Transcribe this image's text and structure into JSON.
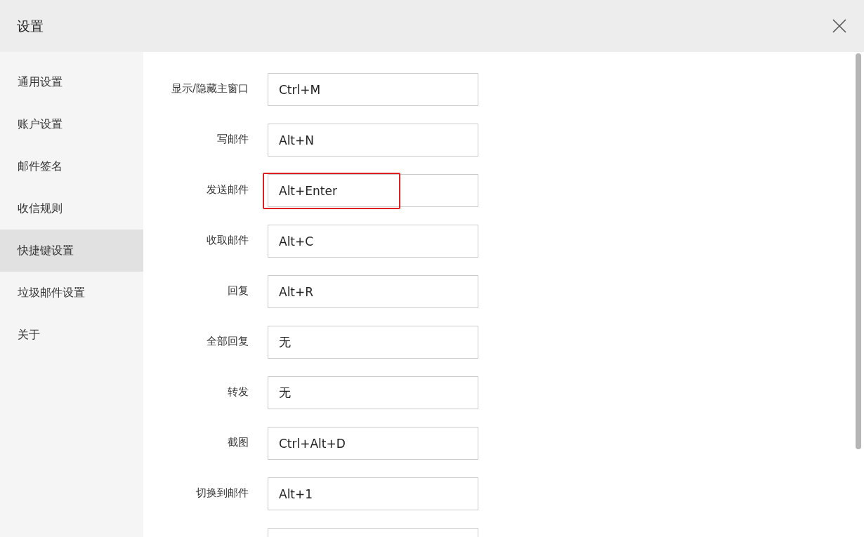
{
  "window": {
    "title": "设置"
  },
  "sidebar": {
    "items": [
      {
        "label": "通用设置",
        "selected": false
      },
      {
        "label": "账户设置",
        "selected": false
      },
      {
        "label": "邮件签名",
        "selected": false
      },
      {
        "label": "收信规则",
        "selected": false
      },
      {
        "label": "快捷键设置",
        "selected": true
      },
      {
        "label": "垃圾邮件设置",
        "selected": false
      },
      {
        "label": "关于",
        "selected": false
      }
    ]
  },
  "shortcuts": [
    {
      "label": "显示/隐藏主窗口",
      "value": "Ctrl+M",
      "highlighted": false
    },
    {
      "label": "写邮件",
      "value": "Alt+N",
      "highlighted": false
    },
    {
      "label": "发送邮件",
      "value": "Alt+Enter",
      "highlighted": true
    },
    {
      "label": "收取邮件",
      "value": "Alt+C",
      "highlighted": false
    },
    {
      "label": "回复",
      "value": "Alt+R",
      "highlighted": false
    },
    {
      "label": "全部回复",
      "value": "无",
      "highlighted": false
    },
    {
      "label": "转发",
      "value": "无",
      "highlighted": false
    },
    {
      "label": "截图",
      "value": "Ctrl+Alt+D",
      "highlighted": false
    },
    {
      "label": "切换到邮件",
      "value": "Alt+1",
      "highlighted": false
    },
    {
      "highlighted": false
    }
  ]
}
